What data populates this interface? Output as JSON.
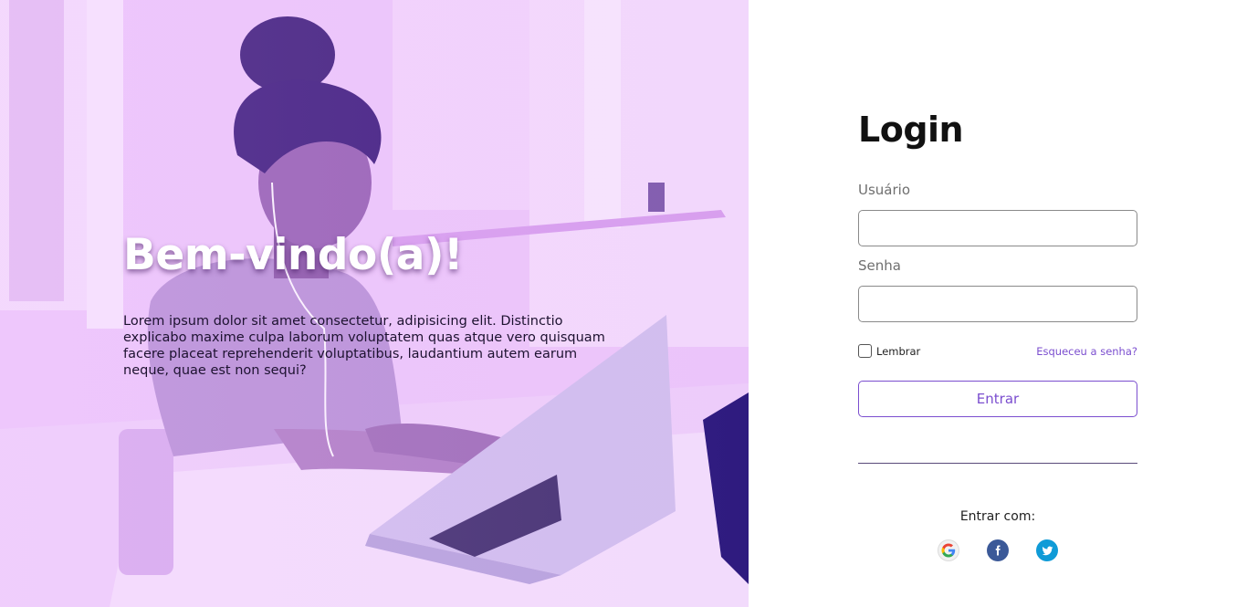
{
  "hero": {
    "title": "Bem-vindo(a)!",
    "description": "Lorem ipsum dolor sit amet consectetur, adipisicing elit. Distinctio explicabo maxime culpa laborum voluptatem quas atque vero quisquam facere placeat reprehenderit voluptatibus, laudantium autem earum neque, quae est non sequi?",
    "photo_icon": "woman-with-laptop-photo",
    "tint_color": "#e4b8f7"
  },
  "login": {
    "title": "Login",
    "username_label": "Usuário",
    "username_value": "",
    "password_label": "Senha",
    "password_value": "",
    "remember_label": "Lembrar",
    "remember_checked": false,
    "forgot_label": "Esqueceu a senha?",
    "submit_label": "Entrar",
    "accent_color": "#7b4ecf"
  },
  "social": {
    "label": "Entrar com:",
    "providers": [
      {
        "name": "google",
        "icon": "google-icon",
        "color": "#f1f1f1"
      },
      {
        "name": "facebook",
        "icon": "facebook-icon",
        "color": "#3b5998"
      },
      {
        "name": "twitter",
        "icon": "twitter-icon",
        "color": "#0f9bd7"
      }
    ]
  }
}
